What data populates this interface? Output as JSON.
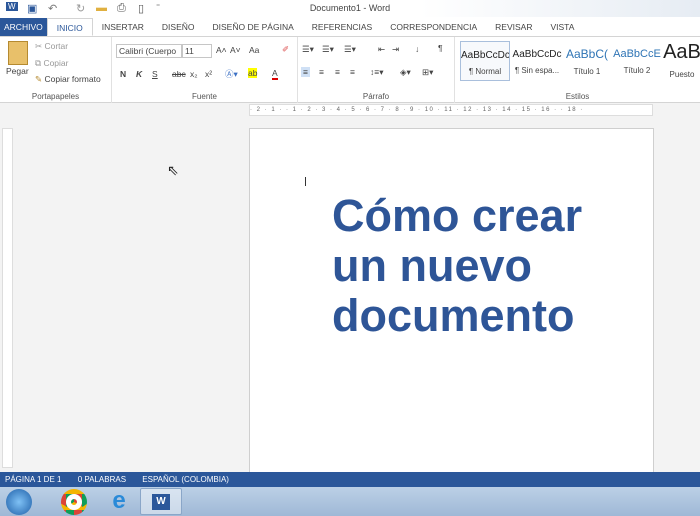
{
  "window": {
    "title": "Documento1 - Word"
  },
  "tabs": [
    "ARCHIVO",
    "INICIO",
    "INSERTAR",
    "DISEÑO",
    "DISEÑO DE PÁGINA",
    "REFERENCIAS",
    "CORRESPONDENCIA",
    "REVISAR",
    "VISTA"
  ],
  "clipboard": {
    "paste": "Pegar",
    "cut": "Cortar",
    "copy": "Copiar",
    "format_painter": "Copiar formato",
    "label": "Portapapeles"
  },
  "font": {
    "name": "Calibri (Cuerpo",
    "size": "11",
    "case": "Aa",
    "bold": "N",
    "italic": "K",
    "underline": "S",
    "strike": "abc",
    "sub": "x₂",
    "sup": "x²",
    "label": "Fuente"
  },
  "paragraph": {
    "label": "Párrafo",
    "pilcrow": "¶"
  },
  "styles": {
    "label": "Estilos",
    "items": [
      {
        "preview": "AaBbCcDc",
        "name": "¶ Normal"
      },
      {
        "preview": "AaBbCcDc",
        "name": "¶ Sin espa..."
      },
      {
        "preview": "AaBbC(",
        "name": "Título 1"
      },
      {
        "preview": "AaBbCcE",
        "name": "Título 2"
      },
      {
        "preview": "AaB",
        "name": "Puesto"
      }
    ]
  },
  "document": {
    "lines": [
      "Cómo crear",
      "un nuevo",
      "documento"
    ],
    "color": "#2e5597"
  },
  "ruler": "· 2 · 1 · · 1 · 2 · 3 · 4 · 5 · 6 · 7 · 8 · 9 · 10 · 11 · 12 · 13 · 14 · 15 · 16 · · 18 ·",
  "status": {
    "page": "PÁGINA 1 DE 1",
    "words": "0 PALABRAS",
    "lang": "ESPAÑOL (COLOMBIA)"
  },
  "taskbar": [
    "start-orb",
    "chrome",
    "internet-explorer",
    "word"
  ],
  "accent": "#2b579a"
}
